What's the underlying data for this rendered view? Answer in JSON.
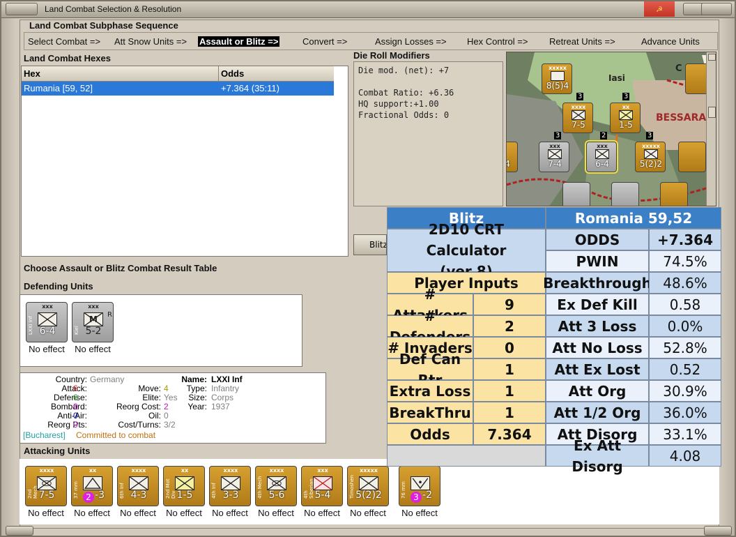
{
  "window": {
    "title": "Land Combat Selection & Resolution"
  },
  "sequence": {
    "heading": "Land Combat Subphase Sequence",
    "steps": [
      "Select Combat =>",
      "Att Snow Units =>",
      "Assault or Blitz =>",
      "Convert =>",
      "Assign Losses =>",
      "Hex Control =>",
      "Retreat Units =>",
      "Advance Units"
    ],
    "selected_index": 2
  },
  "combat_hexes": {
    "heading": "Land Combat Hexes",
    "columns": [
      "Hex",
      "Odds"
    ],
    "rows": [
      {
        "hex": "Rumania [59, 52]",
        "odds": "+7.364 (35:11)"
      }
    ]
  },
  "die_roll": {
    "heading": "Die Roll Modifiers",
    "lines": [
      "Die mod. (net): +7",
      "",
      "Combat Ratio: +6.36",
      "HQ support:+1.00",
      "Fractional Odds: 0"
    ]
  },
  "map": {
    "labels": [
      "Iasi",
      "BESSARA",
      "C"
    ],
    "units": [
      {
        "str": "8(5)4",
        "size": "xxxxx"
      },
      {
        "str": "7-5",
        "size": "xxxx"
      },
      {
        "str": "1-5",
        "size": "xx"
      },
      {
        "str": "7-4",
        "size": "xxx"
      },
      {
        "str": "6-4",
        "size": "xxx"
      },
      {
        "str": "5(2)2",
        "size": "xxxxx"
      },
      {
        "str": "-4",
        "size": ""
      }
    ],
    "badges": [
      "3",
      "2",
      "3",
      "3",
      "3"
    ]
  },
  "blitz_button": {
    "label": "Blitz"
  },
  "choose_text": "Choose Assault or Blitz Combat Result Table",
  "defending": {
    "heading": "Defending Units",
    "units": [
      {
        "name": "LXXI Inf",
        "size": "xxx",
        "strength": "6-4",
        "result": "No effect",
        "corner": "",
        "inner": ""
      },
      {
        "name": "Kiel",
        "size": "xxx",
        "strength": "5-2",
        "result": "No effect",
        "corner": "R",
        "inner": "M"
      }
    ]
  },
  "info": {
    "country_label": "Country:",
    "country": "Germany",
    "attack_label": "Attack:",
    "attack": "6",
    "defense_label": "Defense:",
    "defense": "6",
    "bombard_label": "Bombard:",
    "bombard": "0",
    "antiair_label": "Anti-Air:",
    "antiair": "0",
    "reorg_label": "Reorg Pts:",
    "reorg": "0",
    "move_label": "Move:",
    "move": "4",
    "elite_label": "Elite:",
    "elite": "Yes",
    "reorgcost_label": "Reorg Cost:",
    "reorgcost": "2",
    "oil_label": "Oil:",
    "oil": "0",
    "costturns_label": "Cost/Turns:",
    "costturns": "3/2",
    "name_label": "Name:",
    "name": "LXXI Inf",
    "type_label": "Type:",
    "type": "Infantry",
    "size_label": "Size:",
    "size": "Corps",
    "year_label": "Year:",
    "year": "1937",
    "hq": "[Bucharest]",
    "status": "Committed to combat",
    "colors": {
      "attack": "#d63030",
      "defense": "#2e9a2e",
      "bombard": "#c010c0",
      "antiair": "#1010c0",
      "reorg": "#c010c0",
      "move": "#a0a000",
      "reorgcost": "#c010c0",
      "grey": "#808080",
      "hq": "#20a0a0",
      "status": "#c07010"
    }
  },
  "attacking": {
    "heading": "Attacking Units",
    "units": [
      {
        "name": "2nd Mech",
        "size": "xxxx",
        "strength": "7-5",
        "result": "No effect",
        "badge": ""
      },
      {
        "name": "37 mm",
        "size": "xx",
        "strength": "-3",
        "result": "No effect",
        "badge": "2"
      },
      {
        "name": "6th Inf",
        "size": "xxxx",
        "strength": "4-3",
        "result": "No effect",
        "badge": ""
      },
      {
        "name": "2nd Mot Div",
        "size": "xx",
        "strength": "1-5",
        "result": "No effect",
        "badge": ""
      },
      {
        "name": "4th Inf",
        "size": "xxxx",
        "strength": "3-3",
        "result": "No effect",
        "badge": ""
      },
      {
        "name": "4th Mech",
        "size": "xxxx",
        "strength": "5-6",
        "result": "No effect",
        "badge": ""
      },
      {
        "name": "4th Siberian",
        "size": "xxx",
        "strength": "5-4",
        "result": "No effect",
        "badge": ""
      },
      {
        "name": "Timoshenko",
        "size": "xxxxx",
        "strength": "5(2)2",
        "result": "No effect",
        "badge": ""
      },
      {
        "name": "76 mm",
        "size": "",
        "strength": "-2",
        "result": "No effect",
        "badge": "3"
      }
    ]
  },
  "crt": {
    "blitz": "Blitz",
    "hex_title": "Romania 59,52",
    "calc_title": "2D10 CRT Calculator",
    "calc_ver": "(ver 8)",
    "player_inputs": "Player Inputs",
    "inputs": [
      {
        "label": "# Attackers",
        "value": "9"
      },
      {
        "label": "# Defenders",
        "value": "2"
      },
      {
        "label": "# Invaders",
        "value": "0"
      },
      {
        "label": "Def Can Rtr",
        "value": "1"
      },
      {
        "label": "Extra Loss",
        "value": "1"
      },
      {
        "label": "BreakThru",
        "value": "1"
      },
      {
        "label": "Odds",
        "value": "7.364"
      }
    ],
    "results": [
      {
        "label": "ODDS",
        "value": "+7.364"
      },
      {
        "label": "PWIN",
        "value": "74.5%"
      },
      {
        "label": "Breakthrough",
        "value": "48.6%"
      },
      {
        "label": "Ex Def Kill",
        "value": "0.58"
      },
      {
        "label": "Att 3 Loss",
        "value": "0.0%"
      },
      {
        "label": "Att No Loss",
        "value": "52.8%"
      },
      {
        "label": "Att Ex Lost",
        "value": "0.52"
      },
      {
        "label": "Att Org",
        "value": "30.9%"
      },
      {
        "label": "Att 1/2 Org",
        "value": "36.0%"
      },
      {
        "label": "Att Disorg",
        "value": "33.1%"
      },
      {
        "label": "Ex Att Disorg",
        "value": "4.08"
      }
    ]
  }
}
